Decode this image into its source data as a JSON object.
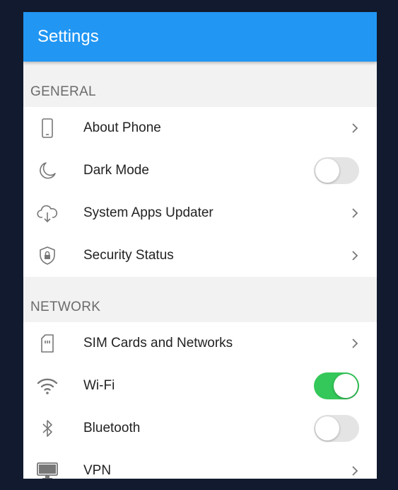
{
  "appbar": {
    "title": "Settings"
  },
  "sections": [
    {
      "header": "GENERAL",
      "items": [
        {
          "label": "About Phone",
          "icon": "phone-icon",
          "control": "chevron"
        },
        {
          "label": "Dark Mode",
          "icon": "moon-icon",
          "control": "toggle",
          "toggle_on": false
        },
        {
          "label": "System Apps Updater",
          "icon": "cloud-download-icon",
          "control": "chevron"
        },
        {
          "label": "Security Status",
          "icon": "shield-lock-icon",
          "control": "chevron"
        }
      ]
    },
    {
      "header": "NETWORK",
      "items": [
        {
          "label": "SIM Cards and Networks",
          "icon": "sim-card-icon",
          "control": "chevron"
        },
        {
          "label": "Wi-Fi",
          "icon": "wifi-icon",
          "control": "toggle",
          "toggle_on": true
        },
        {
          "label": "Bluetooth",
          "icon": "bluetooth-icon",
          "control": "toggle",
          "toggle_on": false
        },
        {
          "label": "VPN",
          "icon": "monitor-icon",
          "control": "chevron"
        }
      ]
    }
  ],
  "colors": {
    "appbar": "#2196f3",
    "toggle_on": "#34c759",
    "toggle_off": "#e4e4e4",
    "icon": "#777777"
  }
}
